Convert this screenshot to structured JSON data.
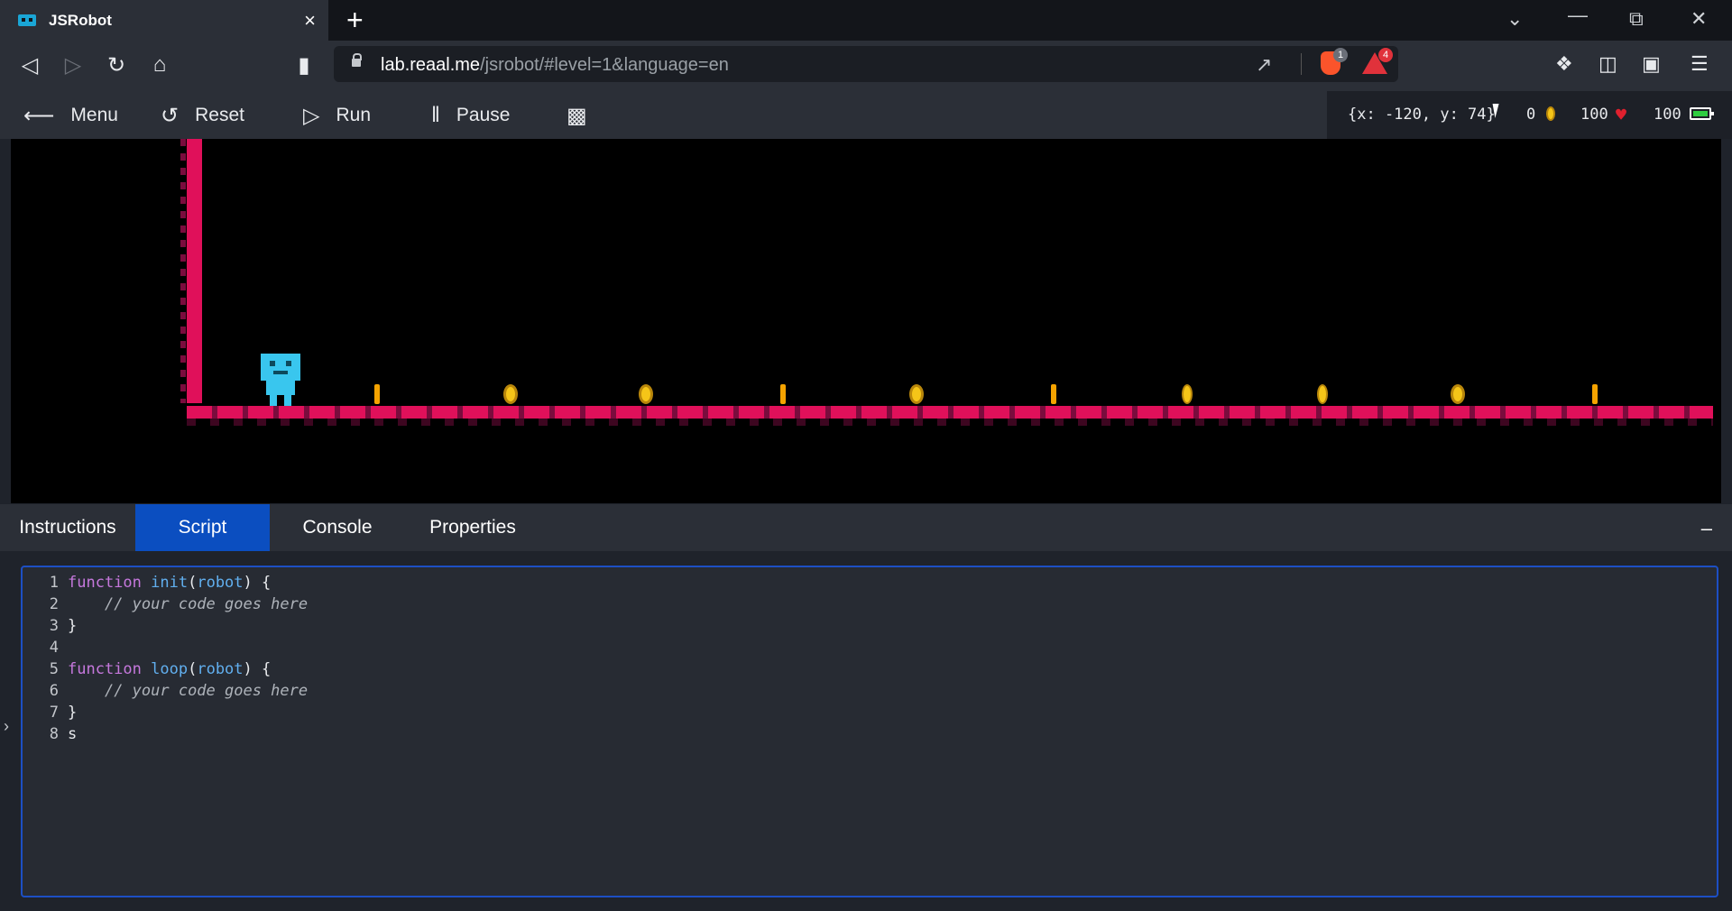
{
  "browser": {
    "tab_title": "JSRobot",
    "tab_close": "×",
    "new_tab": "+",
    "url_host": "lab.reaal.me",
    "url_path": "/jsrobot/#level=1&language=en",
    "brave_badge": "1",
    "rewards_badge": "4"
  },
  "app": {
    "menu_label": "Menu",
    "reset_label": "Reset",
    "run_label": "Run",
    "pause_label": "Pause",
    "coords": "{x: -120, y: 74}",
    "coins": "0",
    "health": "100",
    "energy": "100"
  },
  "panel": {
    "tabs": [
      "Instructions",
      "Script",
      "Console",
      "Properties"
    ],
    "active_tab": "Script",
    "minimize": "–"
  },
  "editor": {
    "lines": [
      {
        "n": "1",
        "tokens": [
          [
            "kw",
            "function"
          ],
          [
            "pl",
            " "
          ],
          [
            "fn",
            "init"
          ],
          [
            "pl",
            "("
          ],
          [
            "param",
            "robot"
          ],
          [
            "pl",
            ") {"
          ]
        ]
      },
      {
        "n": "2",
        "tokens": [
          [
            "pl",
            "    "
          ],
          [
            "cm",
            "// your code goes here"
          ]
        ]
      },
      {
        "n": "3",
        "tokens": [
          [
            "pl",
            "}"
          ]
        ]
      },
      {
        "n": "4",
        "tokens": []
      },
      {
        "n": "5",
        "tokens": [
          [
            "kw",
            "function"
          ],
          [
            "pl",
            " "
          ],
          [
            "fn",
            "loop"
          ],
          [
            "pl",
            "("
          ],
          [
            "param",
            "robot"
          ],
          [
            "pl",
            ") {"
          ]
        ]
      },
      {
        "n": "6",
        "tokens": [
          [
            "pl",
            "    "
          ],
          [
            "cm",
            "// your code goes here"
          ]
        ]
      },
      {
        "n": "7",
        "tokens": [
          [
            "pl",
            "}"
          ]
        ]
      },
      {
        "n": "8",
        "tokens": [
          [
            "pl",
            "s"
          ]
        ]
      }
    ]
  },
  "colors": {
    "accent": "#0b4ec0",
    "wall": "#e0105a",
    "robot": "#39c6ee",
    "coin": "#f5c518"
  }
}
